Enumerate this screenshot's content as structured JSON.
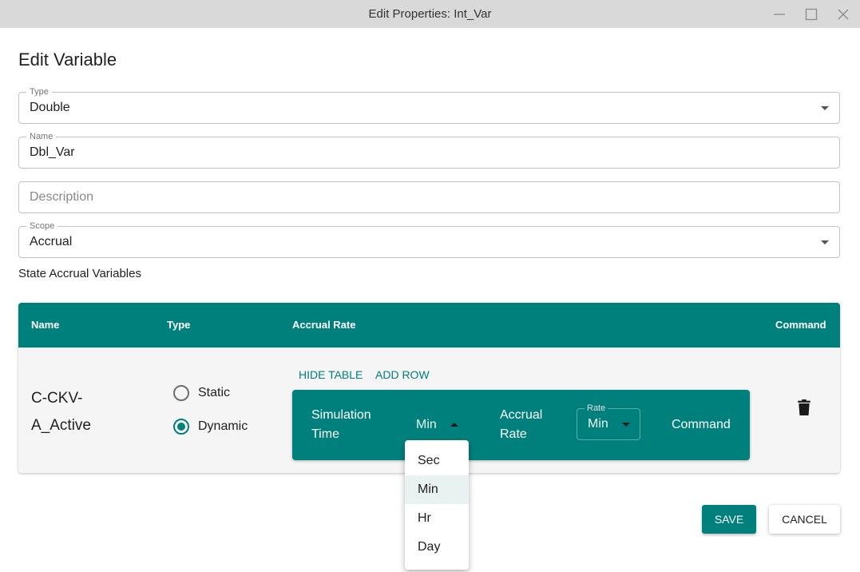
{
  "window": {
    "title": "Edit Properties: Int_Var",
    "controls": [
      "minimize-icon",
      "maximize-icon",
      "close-icon"
    ]
  },
  "dialog": {
    "title": "Edit Variable"
  },
  "form": {
    "type": {
      "label": "Type",
      "value": "Double"
    },
    "name": {
      "label": "Name",
      "value": "Dbl_Var"
    },
    "description": {
      "placeholder": "Description"
    },
    "scope": {
      "label": "Scope",
      "value": "Accrual"
    }
  },
  "section_label": "State Accrual Variables",
  "table": {
    "headers": {
      "name": "Name",
      "type": "Type",
      "accrual_rate": "Accrual Rate",
      "command": "Command"
    },
    "row": {
      "name": "C-CKV-A_Active",
      "type_options": {
        "static": "Static",
        "dynamic": "Dynamic",
        "selected": "Dynamic"
      },
      "actions": {
        "hide_table": "HIDE TABLE",
        "add_row": "ADD ROW"
      },
      "inner_header": {
        "simulation_time": "Simulation Time",
        "sim_unit": "Min",
        "accrual_rate": "Accrual Rate",
        "rate_label": "Rate",
        "rate_unit": "Min",
        "command": "Command"
      },
      "command_icon": "trash-icon"
    }
  },
  "dropdown": {
    "options": [
      "Sec",
      "Min",
      "Hr",
      "Day"
    ],
    "selected": "Min"
  },
  "buttons": {
    "save": "SAVE",
    "cancel": "CANCEL"
  },
  "colors": {
    "accent": "#00807c",
    "titlebar": "#d9d9d9",
    "row_bg": "#f5f5f5"
  }
}
